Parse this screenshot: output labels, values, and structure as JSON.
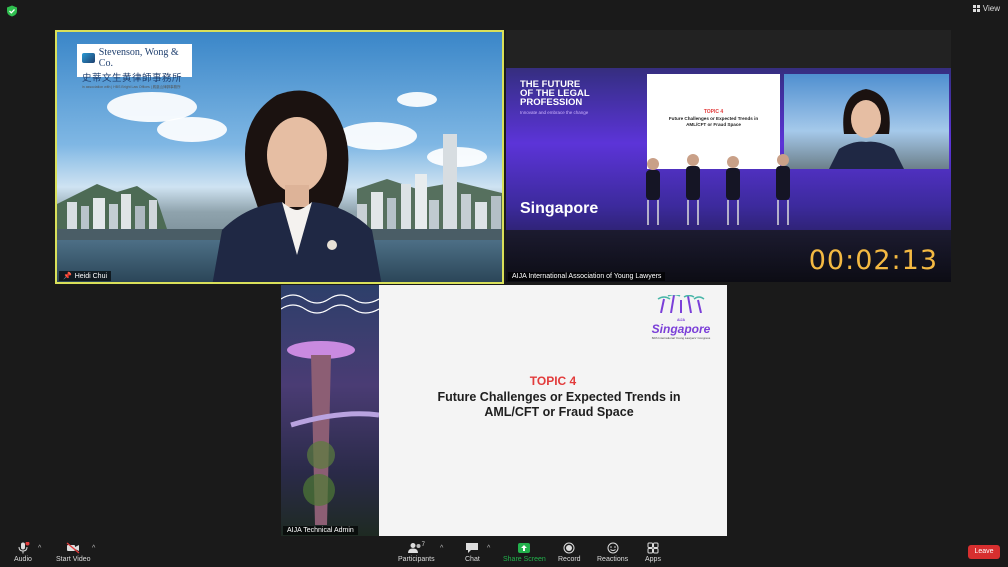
{
  "header": {
    "view_label": "View"
  },
  "tiles": {
    "heidi": {
      "name": "Heidi Chui",
      "logo_line1": "Stevenson, Wong & Co.",
      "logo_line2": "史蒂文生黄律師事務所",
      "logo_line3": "in association with | HBS Bright Law Offices | 鳳凰山律師事務所"
    },
    "conference": {
      "name": "AIJA International Association of Young Lawyers",
      "stage_title": [
        "THE FUTURE",
        "OF THE LEGAL",
        "PROFESSION"
      ],
      "stage_subtitle": "Innovate and embrace the change",
      "stage_city": "Singapore",
      "slide_topic": "TOPIC 4",
      "slide_title": "Future Challenges or Expected Trends in AML/CFT or Fraud Space",
      "timer": "00:02:13"
    },
    "slide": {
      "name": "AIJA Technical Admin",
      "topic": "TOPIC 4",
      "title_line1": "Future Challenges or Expected Trends in",
      "title_line2": "AML/CFT or Fraud Space",
      "logo_prefix": "AIJA",
      "logo_city": "Singapore",
      "logo_sub": "60th International Young Lawyers' Congress"
    }
  },
  "toolbar": {
    "audio": "Audio",
    "start_video": "Start Video",
    "participants": "Participants",
    "participants_count": "7",
    "chat": "Chat",
    "share_screen": "Share Screen",
    "record": "Record",
    "reactions": "Reactions",
    "apps": "Apps",
    "leave": "Leave"
  },
  "colors": {
    "active_speaker_border": "#d9e05a",
    "share_screen_green": "#22b14c",
    "leave_red": "#d72f2f",
    "timer": "#f4b942"
  }
}
